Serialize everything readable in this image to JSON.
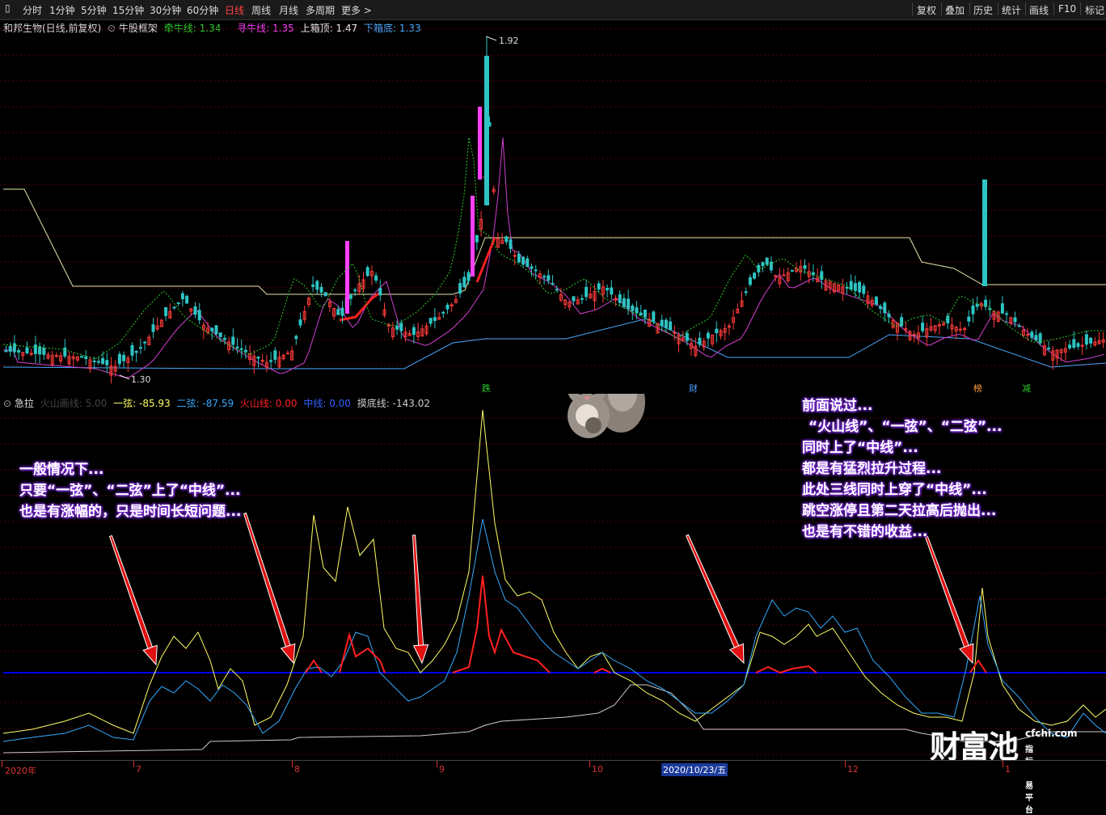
{
  "toolbar": {
    "periods": [
      "分时",
      "1分钟",
      "5分钟",
      "15分钟",
      "30分钟",
      "60分钟",
      "日线",
      "周线",
      "月线",
      "多周期",
      "更多 >"
    ],
    "active": "日线",
    "right_buttons": [
      "复权",
      "叠加",
      "历史",
      "统计",
      "画线",
      "F10",
      "标记"
    ]
  },
  "main_header": {
    "stock": "和邦生物(日线,前复权)",
    "indicator": "牛股框架",
    "l1_name": "牵牛线",
    "l1_val": "1.34",
    "l2_name": "寻牛线",
    "l2_val": "1.35",
    "l3_name": "上箱顶",
    "l3_val": "1.47",
    "l4_name": "下箱底",
    "l4_val": "1.33"
  },
  "sub_header": {
    "indicator": "急拉",
    "p0": "火山画线: 5.00",
    "s1_name": "一弦",
    "s1_val": "-85.93",
    "s2_name": "二弦",
    "s2_val": "-87.59",
    "s3_name": "火山线",
    "s3_val": "0.00",
    "s4_name": "中线",
    "s4_val": "0.00",
    "s5_name": "摸底线",
    "s5_val": "-143.02"
  },
  "price_labels": {
    "high": "1.92",
    "low": "1.30"
  },
  "markers": [
    {
      "text": "跌",
      "color": "#2ecc2e"
    },
    {
      "text": "财",
      "color": "#4aa0ff"
    },
    {
      "text": "榜",
      "color": "#ff9a3a"
    },
    {
      "text": "减",
      "color": "#2ecc2e"
    }
  ],
  "annotations": {
    "left": [
      "一般情况下...",
      "只要“一弦”、“二弦”上了“中线”...",
      "也是有涨幅的，只是时间长短问题..."
    ],
    "right": [
      "前面说过...",
      "“火山线”、“一弦”、“二弦”...",
      "同时上了“中线”...",
      "都是有猛烈拉升过程...",
      "此处三线同时上穿了“中线”...",
      "跳空涨停且第二天拉高后抛出...",
      "也是有不错的收益..."
    ]
  },
  "time_axis": {
    "labels": [
      "2020年",
      "7",
      "8",
      "9",
      "10",
      "2020/10/23/五",
      "12",
      "1"
    ]
  },
  "logo": {
    "brand": "财富池",
    "site": "cfchi.com",
    "slogan": "指标交易平台"
  },
  "colors": {
    "up": "#ff3b3b",
    "down": "#2ec4c4",
    "line1": "#ffff66",
    "line2": "#33aaff",
    "volcano": "#ff2020",
    "mid": "#0000ff",
    "bottom": "#cccccc"
  },
  "chart_data": [
    {
      "type": "candlestick",
      "title": "和邦生物(日线,前复权)",
      "series": [
        {
          "name": "上箱顶",
          "values": [
            1.47,
            1.47,
            1.47,
            1.47,
            1.47
          ]
        },
        {
          "name": "下箱底",
          "values": [
            1.33,
            1.33,
            1.33,
            1.33,
            1.33
          ]
        }
      ],
      "ylim": [
        1.28,
        1.95
      ],
      "price_high": 1.92,
      "price_low": 1.3
    },
    {
      "type": "line",
      "title": "急拉",
      "series": [
        {
          "name": "一弦",
          "color": "#ffff66"
        },
        {
          "name": "二弦",
          "color": "#33aaff"
        },
        {
          "name": "火山线",
          "color": "#ff2020"
        },
        {
          "name": "中线",
          "color": "#0000ff"
        },
        {
          "name": "摸底线",
          "color": "#cccccc"
        }
      ]
    }
  ]
}
